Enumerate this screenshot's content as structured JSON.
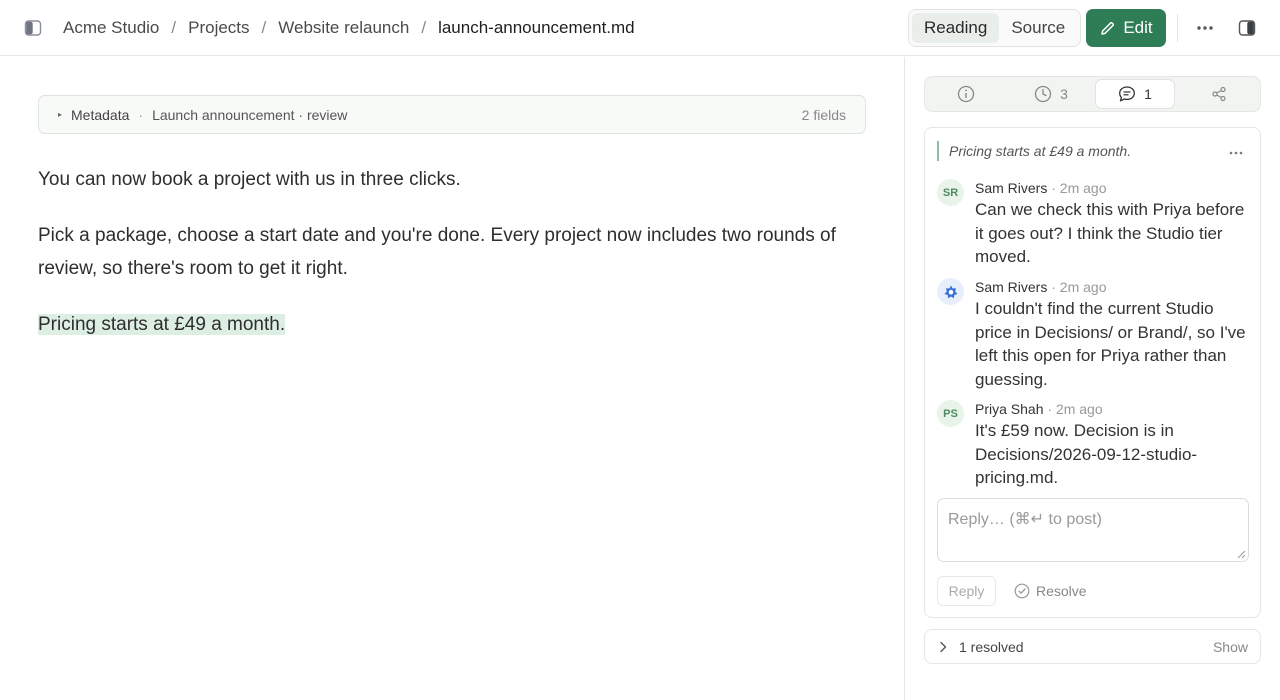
{
  "breadcrumb": {
    "items": [
      "Acme Studio",
      "Projects",
      "Website relaunch"
    ],
    "current": "launch-announcement.md",
    "separator": "/"
  },
  "header": {
    "modes": [
      "Reading",
      "Source"
    ],
    "active_mode": "Reading",
    "edit_label": "Edit",
    "accent": "#2f7d56"
  },
  "metadata": {
    "label": "Metadata",
    "dot": "·",
    "summary": "Launch announcement · review",
    "fields_count": "2 fields"
  },
  "document": {
    "paragraphs": [
      "You can now book a project with us in three clicks.",
      "Pick a package, choose a start date and you're done. Every project now includes two rounds of review, so there's room to get it right."
    ],
    "highlighted": "Pricing starts at £49 a month.",
    "highlight_color": "#dcefe2"
  },
  "panel": {
    "tabs": [
      {
        "icon": "info-icon",
        "count": ""
      },
      {
        "icon": "history-icon",
        "count": "3"
      },
      {
        "icon": "comment-icon",
        "count": "1"
      },
      {
        "icon": "share-icon",
        "count": ""
      }
    ],
    "active_tab": 2,
    "thread": {
      "quote": "Pricing starts at £49 a month.",
      "comments": [
        {
          "initials": "SR",
          "author": "Sam Rivers",
          "time": "· 2m ago",
          "text": "Can we check this with Priya before it goes out? I think the Studio tier moved."
        },
        {
          "initials": "",
          "avatar_icon": "bot-icon",
          "author": "Sam Rivers",
          "time": "· 2m ago",
          "text": "I couldn't find the current Studio price in Decisions/ or Brand/, so I've left this open for Priya rather than guessing."
        },
        {
          "initials": "PS",
          "author": "Priya Shah",
          "time": "· 2m ago",
          "text": "It's £59 now. Decision is in Decisions/2026-09-12-studio-pricing.md."
        }
      ],
      "reply_placeholder": "Reply…  (⌘↵ to post)",
      "reply_label": "Reply",
      "resolve_label": "Resolve"
    },
    "resolved": {
      "label": "1 resolved",
      "show_label": "Show"
    }
  }
}
